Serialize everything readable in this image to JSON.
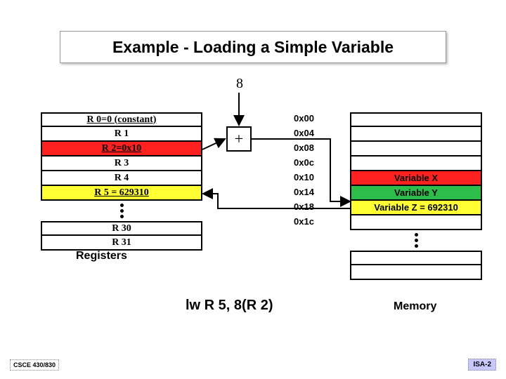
{
  "title": "Example - Loading a Simple Variable",
  "offset_label": "8",
  "adder_symbol": "+",
  "registers": {
    "top": [
      {
        "label": "R 0=0 (constant)",
        "underline": true,
        "bg": "bg-white"
      },
      {
        "label": "R 1",
        "underline": false,
        "bg": "bg-white"
      },
      {
        "label": "R 2=0x10",
        "underline": true,
        "bg": "bg-red"
      },
      {
        "label": "R 3",
        "underline": false,
        "bg": "bg-white"
      },
      {
        "label": "R 4",
        "underline": false,
        "bg": "bg-white"
      },
      {
        "label": "R 5 = 629310",
        "underline": true,
        "bg": "bg-yellow"
      }
    ],
    "bottom": [
      {
        "label": "R 30",
        "underline": false,
        "bg": "bg-white"
      },
      {
        "label": "R 31",
        "underline": false,
        "bg": "bg-white"
      }
    ],
    "section_label": "Registers"
  },
  "addresses": [
    "0x00",
    "0x04",
    "0x08",
    "0x0c",
    "0x10",
    "0x14",
    "0x18",
    "0x1c"
  ],
  "memory": {
    "top": [
      {
        "label": "",
        "bg": "bg-white"
      },
      {
        "label": "",
        "bg": "bg-white"
      },
      {
        "label": "",
        "bg": "bg-white"
      },
      {
        "label": "",
        "bg": "bg-white"
      },
      {
        "label": "Variable X",
        "bg": "bg-red"
      },
      {
        "label": "Variable Y",
        "bg": "bg-green"
      },
      {
        "label": "Variable Z = 692310",
        "bg": "bg-yellow"
      },
      {
        "label": "",
        "bg": "bg-white"
      }
    ],
    "bottom": [
      {
        "label": "",
        "bg": "bg-white"
      },
      {
        "label": "",
        "bg": "bg-white"
      }
    ],
    "section_label": "Memory"
  },
  "instruction": "lw R 5, 8(R 2)",
  "footer": {
    "left": "CSCE 430/830",
    "right": "ISA-2"
  },
  "colors": {
    "red": "#ff2020",
    "green": "#2dbd4a",
    "yellow": "#ffff33"
  }
}
